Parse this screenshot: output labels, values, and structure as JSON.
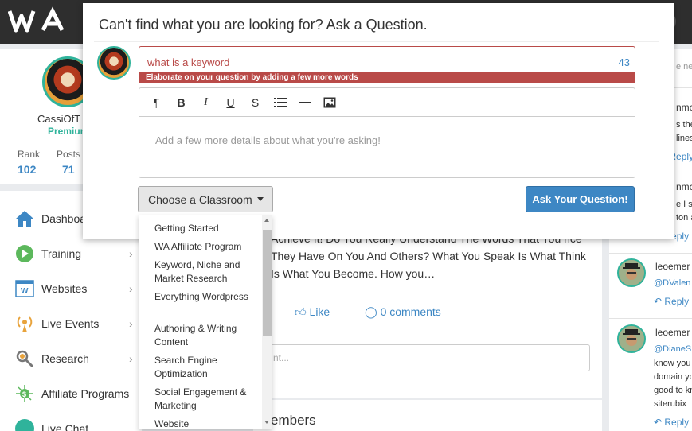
{
  "profile": {
    "name": "CassiOfT",
    "role": "Premium",
    "stats": [
      {
        "label": "Rank",
        "value": "102"
      },
      {
        "label": "Posts",
        "value": "71"
      }
    ]
  },
  "nav": {
    "items": [
      {
        "label": "Dashboa",
        "icon": "home-icon"
      },
      {
        "label": "Training",
        "icon": "play-icon"
      },
      {
        "label": "Websites",
        "icon": "websites-icon"
      },
      {
        "label": "Live Events",
        "icon": "live-events-icon"
      },
      {
        "label": "Research",
        "icon": "research-icon"
      },
      {
        "label": "Affiliate Programs",
        "icon": "affiliate-icon"
      },
      {
        "label": "Live Chat",
        "icon": "chat-icon"
      }
    ]
  },
  "modal": {
    "title": "Can't find what you are looking for? Ask a Question.",
    "question_value": "what is a keyword",
    "char_count": "43",
    "error": "Elaborate on your question by adding a few more words",
    "details_placeholder": "Add a few more details about what you're asking!",
    "classroom_label": "Choose a Classroom",
    "ask_label": "Ask Your Question!",
    "toolbar": [
      "paragraph-icon",
      "bold-icon",
      "italic-icon",
      "underline-icon",
      "strikethrough-icon",
      "list-icon",
      "horizontal-rule-icon",
      "image-icon"
    ]
  },
  "dropdown": {
    "items": [
      "Getting Started",
      "WA Affiliate Program",
      "Keyword, Niche and Market Research",
      "Everything Wordpress",
      "Authoring & Writing Content",
      "Search Engine Optimization",
      "Social Engagement & Marketing",
      "Website"
    ]
  },
  "post": {
    "text": "Achieve It! Do You Really Understand The Words That You nce They Have On You And Others? What You Speak Is What Think Is What You Become. How you…",
    "like_label": "Like",
    "comments_label": "0 comments",
    "comment_placeholder": "nt...",
    "members_title": "embers"
  },
  "right": {
    "fragments": {
      "f1": "e ne",
      "f2": "nmc",
      "f3": "s the",
      "f4": "lines",
      "f5": "nmc",
      "f6": "e I s",
      "f7": "ton a"
    },
    "reply_label": "Reply",
    "comments": [
      {
        "name": "leoemer",
        "mention": "@DValen"
      },
      {
        "name": "leoemer",
        "mention": "@DianeS",
        "lines": [
          "know you",
          "domain yo",
          "good to kn",
          "siterubix"
        ]
      }
    ]
  },
  "colors": {
    "accent": "#3d87c4",
    "error": "#b94a48",
    "premium": "#2fb39b",
    "topbar": "#2e2e2e"
  }
}
